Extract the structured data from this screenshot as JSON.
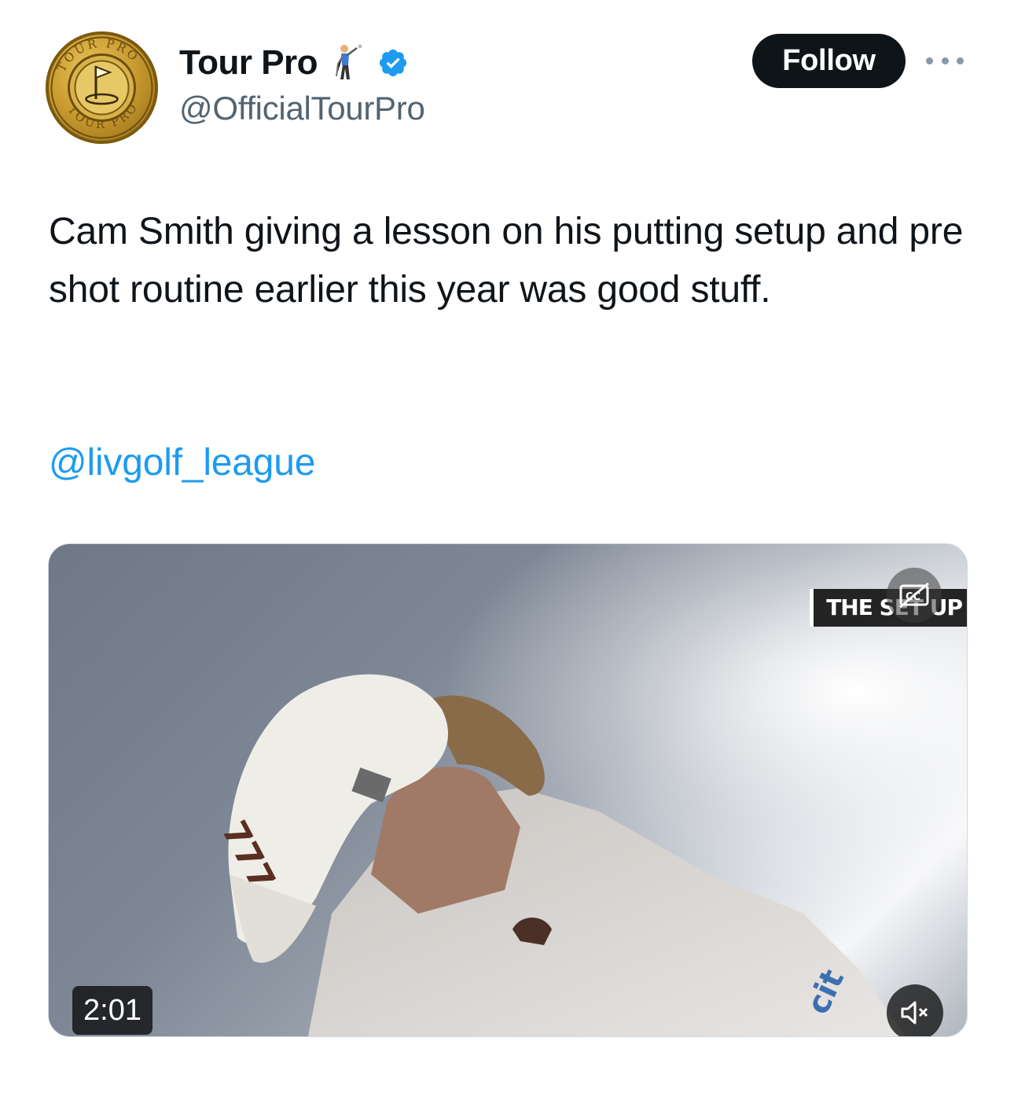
{
  "author": {
    "display_name": "Tour Pro",
    "handle": "@OfficialTourPro",
    "verified": true,
    "avatar_text": "TOUR PRO",
    "emoji_icon": "golfer-icon"
  },
  "actions": {
    "follow_label": "Follow",
    "more_icon": "more-icon"
  },
  "tweet": {
    "text": "Cam Smith giving a lesson on his putting setup and pre shot routine earlier this year was good stuff.",
    "mention": "@livgolf_league"
  },
  "video": {
    "overlay_title": "THE SET UP",
    "duration": "2:01",
    "muted": true,
    "cc_icon": "closed-captions-icon",
    "mute_icon": "speaker-muted-icon"
  },
  "colors": {
    "link": "#1d9bf0",
    "follow_bg": "#0f1419",
    "verified": "#1d9bf0",
    "handle": "#536471"
  }
}
